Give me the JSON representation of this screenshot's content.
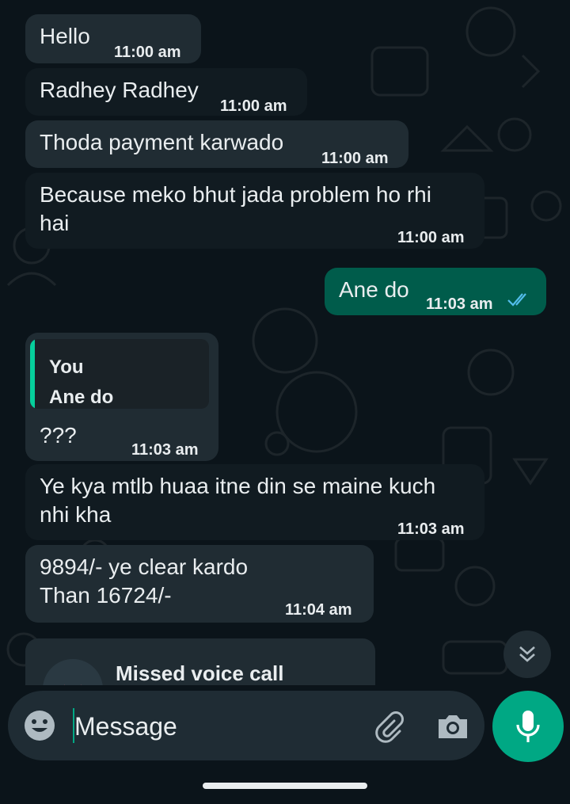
{
  "messages": [
    {
      "text": "Hello",
      "time": "11:00 am"
    },
    {
      "text": "Radhey Radhey",
      "time": "11:00 am"
    },
    {
      "text": "Thoda payment karwado",
      "time": "11:00 am"
    },
    {
      "line1": "Because meko bhut jada problem ho rhi",
      "line2": "hai",
      "time": "11:00 am"
    },
    {
      "text": "Ane do",
      "time": "11:03 am",
      "status": "read-double-check-icon"
    },
    {
      "reply_author": "You",
      "reply_text": "Ane do",
      "text": "???",
      "time": "11:03 am"
    },
    {
      "line1": "Ye kya mtlb huaa itne din se maine kuch",
      "line2": "nhi kha",
      "time": "11:03 am"
    },
    {
      "line1": "9894/- ye  clear kardo",
      "line2": "Than 16724/-",
      "time": "11:04 am"
    },
    {
      "text": "Missed voice call"
    }
  ],
  "composer": {
    "placeholder": "Message"
  },
  "icons": {
    "emoji": "emoji-icon",
    "attach": "paperclip-icon",
    "camera": "camera-icon",
    "mic": "microphone-icon",
    "scroll": "chevron-double-down-icon",
    "missed_call": "missed-call-icon"
  },
  "colors": {
    "background": "#0b141a",
    "incoming": "#202c33",
    "outgoing": "#005c4b",
    "accent": "#00a884",
    "read_ticks": "#53bdeb"
  }
}
